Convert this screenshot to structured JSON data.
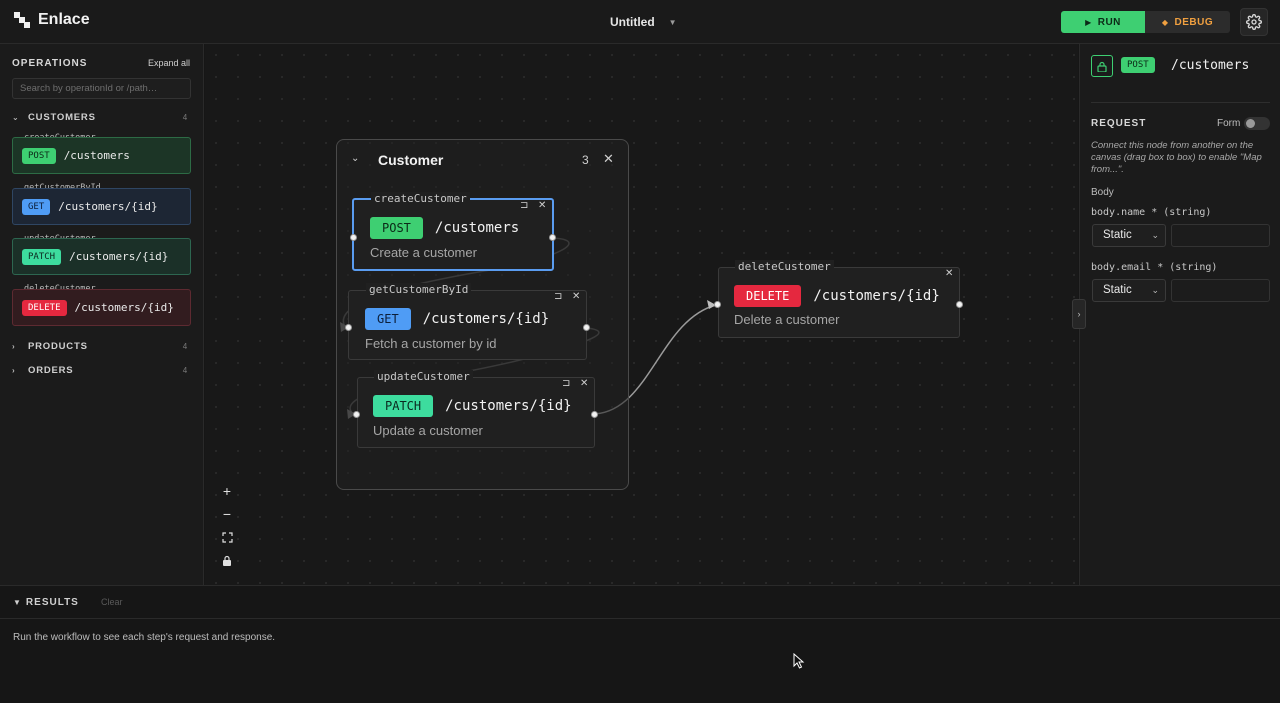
{
  "app": {
    "name": "Enlace",
    "doc_title": "Untitled"
  },
  "toolbar": {
    "run_label": "RUN",
    "debug_label": "DEBUG"
  },
  "sidebar": {
    "title": "OPERATIONS",
    "expand_all": "Expand all",
    "search_placeholder": "Search by operationId or /path…",
    "groups": [
      {
        "name": "CUSTOMERS",
        "count": "4"
      },
      {
        "name": "PRODUCTS",
        "count": "4"
      },
      {
        "name": "ORDERS",
        "count": "4"
      }
    ],
    "operations": [
      {
        "id": "createCustomer",
        "method": "POST",
        "path": "/customers"
      },
      {
        "id": "getCustomerById",
        "method": "GET",
        "path": "/customers/{id}"
      },
      {
        "id": "updateCustomer",
        "method": "PATCH",
        "path": "/customers/{id}"
      },
      {
        "id": "deleteCustomer",
        "method": "DELETE",
        "path": "/customers/{id}"
      }
    ]
  },
  "canvas": {
    "group": {
      "title": "Customer",
      "count": "3"
    },
    "nodes": [
      {
        "id": "createCustomer",
        "method": "POST",
        "path": "/customers",
        "desc": "Create a customer"
      },
      {
        "id": "getCustomerById",
        "method": "GET",
        "path": "/customers/{id}",
        "desc": "Fetch a customer by id"
      },
      {
        "id": "updateCustomer",
        "method": "PATCH",
        "path": "/customers/{id}",
        "desc": "Update a customer"
      },
      {
        "id": "deleteCustomer",
        "method": "DELETE",
        "path": "/customers/{id}",
        "desc": "Delete a customer"
      }
    ],
    "zoom_controls": [
      "+",
      "−"
    ]
  },
  "inspector": {
    "method": "POST",
    "path": "/customers",
    "section": "REQUEST",
    "form_label": "Form",
    "hint": "Connect this node from another on the canvas (drag box to box) to enable \"Map from...\".",
    "body_label": "Body",
    "fields": [
      {
        "label": "body.name * (string)",
        "mode": "Static"
      },
      {
        "label": "body.email * (string)",
        "mode": "Static"
      }
    ]
  },
  "results": {
    "title": "RESULTS",
    "clear": "Clear",
    "message": "Run the workflow to see each step's request and response."
  },
  "colors": {
    "post": "#3ecf72",
    "get": "#4f9cf5",
    "patch": "#3ddc9e",
    "delete": "#e5283f",
    "debug": "#f0a040",
    "selected": "#5a9cf0"
  }
}
